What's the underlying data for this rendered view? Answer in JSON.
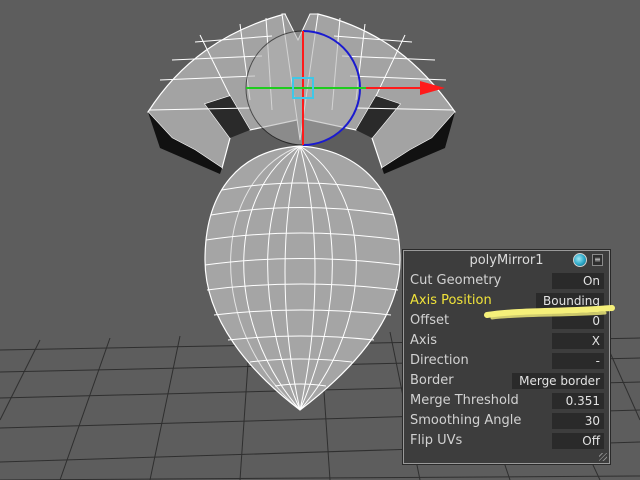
{
  "panel": {
    "title": "polyMirror1",
    "icons": {
      "node": "shading-sphere-icon",
      "menu": "panel-menu-icon"
    },
    "attributes": [
      {
        "label": "Cut Geometry",
        "value": "On",
        "highlighted": false
      },
      {
        "label": "Axis Position",
        "value": "Bounding",
        "highlighted": true
      },
      {
        "label": "Offset",
        "value": "0",
        "highlighted": false
      },
      {
        "label": "Axis",
        "value": "X",
        "highlighted": false
      },
      {
        "label": "Direction",
        "value": "-",
        "highlighted": false
      },
      {
        "label": "Border",
        "value": "Merge border",
        "highlighted": false
      },
      {
        "label": "Merge Threshold",
        "value": "0.351",
        "highlighted": false
      },
      {
        "label": "Smoothing Angle",
        "value": "30",
        "highlighted": false
      },
      {
        "label": "Flip UVs",
        "value": "Off",
        "highlighted": false
      }
    ]
  },
  "colors": {
    "viewport_background": "#5d5d5d",
    "mesh_fill": "#a3a3a3",
    "wireframe": "#ffffff",
    "highlight_label": "#f0e33a",
    "manipulator_x": "#ff1a1a",
    "manipulator_y": "#1ecc1e",
    "manipulator_z": "#1a1ad0",
    "center_handle": "#3fc8e8",
    "annotation_stroke": "#f5f07a"
  }
}
